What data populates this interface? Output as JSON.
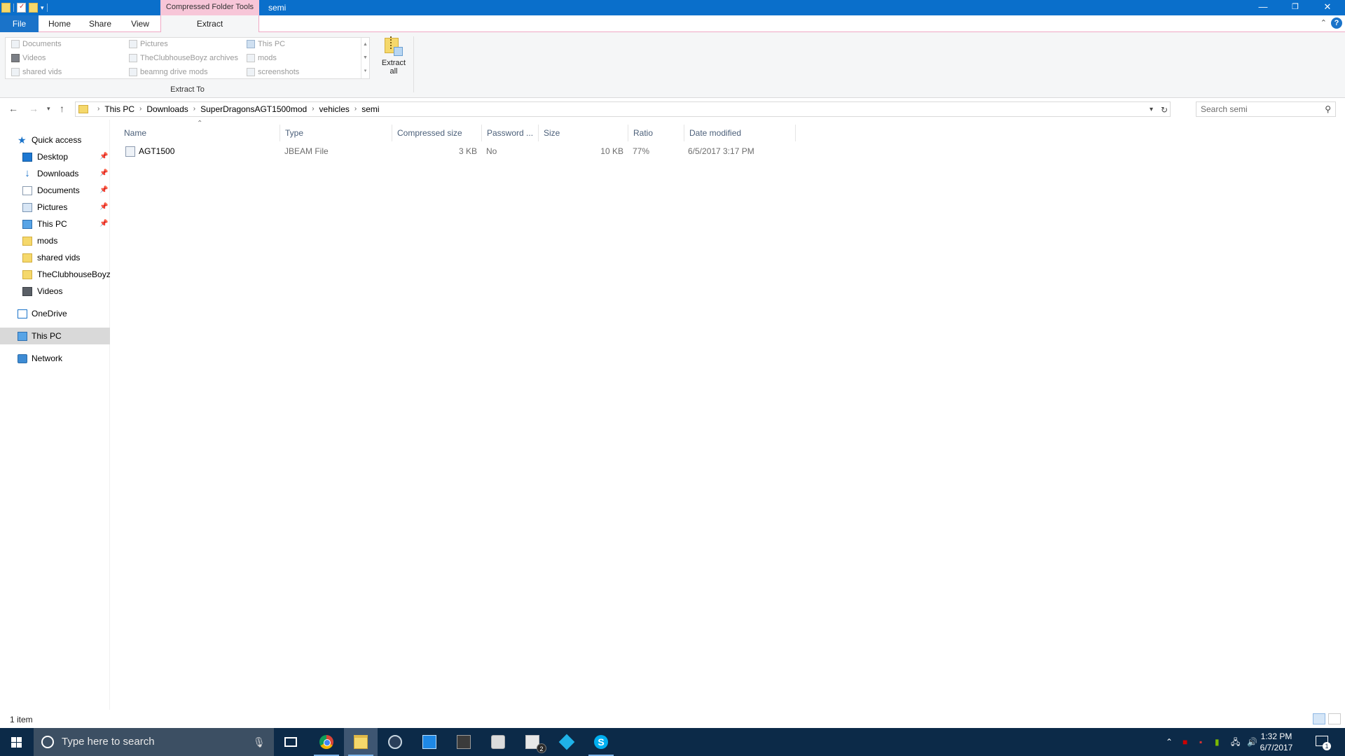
{
  "window": {
    "title": "semi",
    "context_tab_title": "Compressed Folder Tools",
    "controls": {
      "minimize": "—",
      "restore": "❐",
      "close": "✕"
    }
  },
  "ribbon": {
    "tabs": {
      "file": "File",
      "home": "Home",
      "share": "Share",
      "view": "View",
      "extract": "Extract"
    },
    "destinations": [
      {
        "label": "Documents",
        "icon": "documents-icon"
      },
      {
        "label": "Videos",
        "icon": "videos-icon"
      },
      {
        "label": "shared vids",
        "icon": "folder-icon"
      },
      {
        "label": "Pictures",
        "icon": "pictures-icon"
      },
      {
        "label": "TheClubhouseBoyz archives",
        "icon": "folder-icon"
      },
      {
        "label": "beamng drive mods",
        "icon": "folder-icon"
      },
      {
        "label": "This PC",
        "icon": "this-pc-icon"
      },
      {
        "label": "mods",
        "icon": "folder-icon"
      },
      {
        "label": "screenshots",
        "icon": "folder-icon"
      }
    ],
    "group_label": "Extract To",
    "extract_all_line1": "Extract",
    "extract_all_line2": "all"
  },
  "address": {
    "breadcrumb": [
      "This PC",
      "Downloads",
      "SuperDragonsAGT1500mod",
      "vehicles",
      "semi"
    ],
    "search_placeholder": "Search semi"
  },
  "navigation": {
    "items": [
      {
        "label": "Quick access",
        "icon": "star-icon"
      },
      {
        "label": "Desktop",
        "icon": "desktop-icon",
        "pinned": true
      },
      {
        "label": "Downloads",
        "icon": "download-arrow-icon",
        "pinned": true
      },
      {
        "label": "Documents",
        "icon": "documents-icon",
        "pinned": true
      },
      {
        "label": "Pictures",
        "icon": "pictures-icon",
        "pinned": true
      },
      {
        "label": "This PC",
        "icon": "this-pc-icon",
        "pinned": true
      },
      {
        "label": "mods",
        "icon": "folder-icon"
      },
      {
        "label": "shared vids",
        "icon": "folder-icon"
      },
      {
        "label": "TheClubhouseBoyz",
        "icon": "folder-icon"
      },
      {
        "label": "Videos",
        "icon": "videos-icon"
      },
      {
        "label": "OneDrive",
        "icon": "onedrive-icon"
      },
      {
        "label": "This PC",
        "icon": "this-pc-icon",
        "selected": true
      },
      {
        "label": "Network",
        "icon": "network-icon"
      }
    ]
  },
  "filelist": {
    "columns": [
      "Name",
      "Type",
      "Compressed size",
      "Password ...",
      "Size",
      "Ratio",
      "Date modified"
    ],
    "rows": [
      {
        "name": "AGT1500",
        "type": "JBEAM File",
        "compressed_size": "3 KB",
        "password": "No",
        "size": "10 KB",
        "ratio": "77%",
        "date_modified": "6/5/2017 3:17 PM"
      }
    ]
  },
  "status": {
    "item_count": "1 item"
  },
  "taskbar": {
    "search_placeholder": "Type here to search",
    "apps": [
      "task-view",
      "chrome",
      "file-explorer",
      "steam",
      "store",
      "game",
      "file-manager",
      "mail",
      "kodi",
      "skype"
    ],
    "mail_badge": "2",
    "skype_letter": "S",
    "clock_time": "1:32 PM",
    "clock_date": "6/7/2017",
    "notification_count": "1"
  }
}
